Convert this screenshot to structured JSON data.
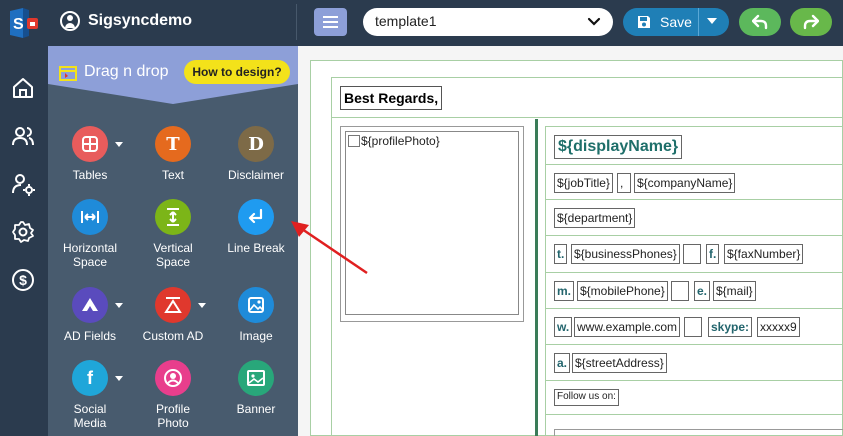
{
  "header": {
    "app_name": "Sigsyncdemo",
    "template_value": "template1",
    "save_label": "Save"
  },
  "panel": {
    "title": "Drag n drop",
    "help_label": "How to design?",
    "tools": [
      {
        "label": "Tables",
        "glyph": "",
        "color": "#e85c5c",
        "icon": "table-icon",
        "caret": true
      },
      {
        "label": "Text",
        "glyph": "T",
        "color": "#e56a1e",
        "icon": "text-icon",
        "caret": false
      },
      {
        "label": "Disclaimer",
        "glyph": "D",
        "color": "#7d6a47",
        "icon": "disclaimer-icon",
        "caret": false
      },
      {
        "label": "Horizontal\nSpace",
        "glyph": "",
        "color": "#1f8bd9",
        "icon": "horizontal-space-icon",
        "caret": false
      },
      {
        "label": "Vertical\nSpace",
        "glyph": "",
        "color": "#7cb518",
        "icon": "vertical-space-icon",
        "caret": false
      },
      {
        "label": "Line Break",
        "glyph": "",
        "color": "#1f9bf0",
        "icon": "line-break-icon",
        "caret": false
      },
      {
        "label": "AD Fields",
        "glyph": "",
        "color": "#5a4bbd",
        "icon": "ad-fields-icon",
        "caret": true
      },
      {
        "label": "Custom AD",
        "glyph": "",
        "color": "#e0382d",
        "icon": "custom-ad-icon",
        "caret": true
      },
      {
        "label": "Image",
        "glyph": "",
        "color": "#1f8bd9",
        "icon": "image-icon",
        "caret": false
      },
      {
        "label": "Social\nMedia",
        "glyph": "f",
        "color": "#1fa6d9",
        "icon": "social-media-icon",
        "caret": true
      },
      {
        "label": "Profile\nPhoto",
        "glyph": "",
        "color": "#e83e8c",
        "icon": "profile-photo-icon",
        "caret": false
      },
      {
        "label": "Banner",
        "glyph": "",
        "color": "#28a77a",
        "icon": "banner-icon",
        "caret": false
      }
    ]
  },
  "signature": {
    "regards": "Best Regards,",
    "profile_photo": "${profilePhoto}",
    "display_name": "${displayName}",
    "job_title": "${jobTitle}",
    "comma": ",",
    "company_name": "${companyName}",
    "department": "${department}",
    "phone_prefix": "t.",
    "business_phones": "${businessPhones}",
    "fax_prefix": "f.",
    "fax_number": "${faxNumber}",
    "mobile_prefix": "m.",
    "mobile_phone": "${mobilePhone}",
    "email_prefix": "e.",
    "mail": "${mail}",
    "web_prefix": "w.",
    "website": "www.example.com",
    "skype_label": "skype:",
    "skype_value": "xxxxx9",
    "address_prefix": "a.",
    "street_address": "${streetAddress}",
    "follow_label": "Follow us on:"
  },
  "colors": {
    "topbar": "#2b3b4e",
    "panel": "#485b6e",
    "panel_header": "#8d9fd8",
    "save": "#1f7fb6",
    "undo": "#5cb85c",
    "arrow": "#e02020"
  }
}
